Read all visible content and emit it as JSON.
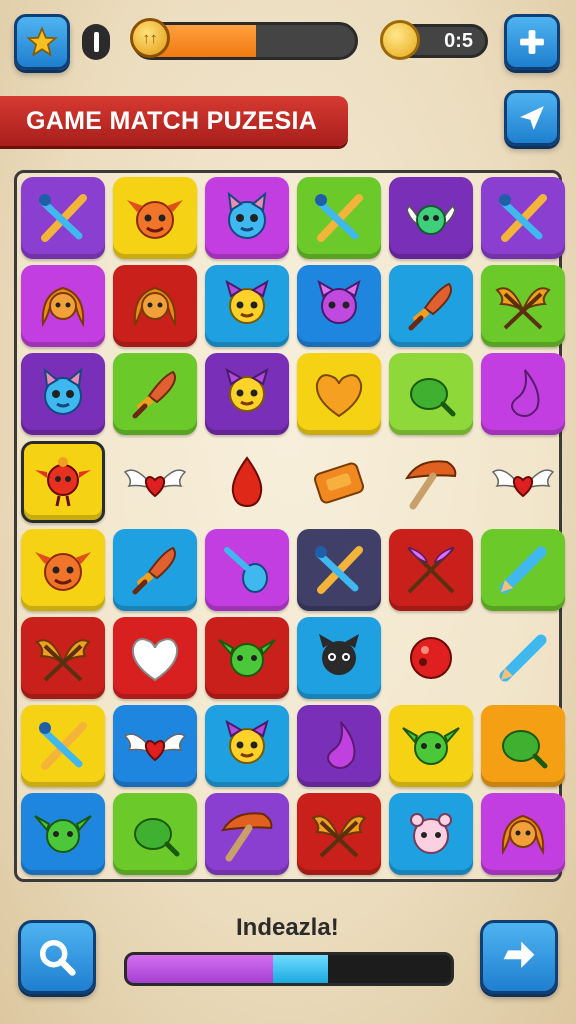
{
  "header": {
    "star_icon": "star-icon",
    "pause_icon": "pause-icon",
    "level_progress": 0.55,
    "coin_symbol": "↑↑",
    "timer": "0:5",
    "plus_icon": "plus-icon",
    "send_icon": "send-icon"
  },
  "title": "GAME MATCH PUZESIA",
  "board": {
    "rows": [
      [
        {
          "color": "#8b3fd0",
          "icon": "sword"
        },
        {
          "color": "#f5d214",
          "icon": "orange-monster"
        },
        {
          "color": "#c23ee0",
          "icon": "blue-cat"
        },
        {
          "color": "#6cc92a",
          "icon": "sword"
        },
        {
          "color": "#7a2fb8",
          "icon": "winged-creature"
        },
        {
          "color": "#8b3fd0",
          "icon": "sword"
        }
      ],
      [
        {
          "color": "#c23ee0",
          "icon": "orange-girl"
        },
        {
          "color": "#c9201c",
          "icon": "orange-girl"
        },
        {
          "color": "#1fa0e0",
          "icon": "yellow-cat"
        },
        {
          "color": "#1f86e0",
          "icon": "purple-cat"
        },
        {
          "color": "#1fa0e0",
          "icon": "feather-dagger"
        },
        {
          "color": "#6cc92a",
          "icon": "golden-wings"
        }
      ],
      [
        {
          "color": "#7a2fb8",
          "icon": "blue-cat"
        },
        {
          "color": "#6cc92a",
          "icon": "feather-dagger"
        },
        {
          "color": "#7a2fb8",
          "icon": "yellow-cat"
        },
        {
          "color": "#f5d214",
          "icon": "heart"
        },
        {
          "color": "#8ed83a",
          "icon": "green-gourd"
        },
        {
          "color": "#c23ee0",
          "icon": "drop"
        }
      ],
      [
        {
          "color": "#f5d214",
          "icon": "red-bird",
          "selected": true
        },
        {
          "color": "",
          "icon": "winged-heart"
        },
        {
          "color": "",
          "icon": "red-drop"
        },
        {
          "color": "",
          "icon": "orange-block"
        },
        {
          "color": "",
          "icon": "mushroom"
        },
        {
          "color": "",
          "icon": "winged-heart"
        }
      ],
      [
        {
          "color": "#f5d214",
          "icon": "orange-monster"
        },
        {
          "color": "#1fa0e0",
          "icon": "feather-dagger"
        },
        {
          "color": "#c23ee0",
          "icon": "blue-spoon"
        },
        {
          "color": "#3f3f68",
          "icon": "sword"
        },
        {
          "color": "#c9201c",
          "icon": "crossed-arrows"
        },
        {
          "color": "#6cc92a",
          "icon": "pencil"
        }
      ],
      [
        {
          "color": "#c9201c",
          "icon": "golden-wings"
        },
        {
          "color": "#d82020",
          "icon": "white-heart"
        },
        {
          "color": "#c9201c",
          "icon": "green-goblin"
        },
        {
          "color": "#1fa0e0",
          "icon": "black-cat"
        },
        {
          "color": "",
          "icon": "red-ball"
        },
        {
          "color": "",
          "icon": "pencil"
        }
      ],
      [
        {
          "color": "#f5d214",
          "icon": "sword"
        },
        {
          "color": "#1f86e0",
          "icon": "winged-heart"
        },
        {
          "color": "#1fa0e0",
          "icon": "yellow-cat"
        },
        {
          "color": "#7a2fb8",
          "icon": "drop"
        },
        {
          "color": "#f5d214",
          "icon": "green-goblin"
        },
        {
          "color": "#f5a014",
          "icon": "green-gourd"
        }
      ],
      [
        {
          "color": "#1f86e0",
          "icon": "green-goblin"
        },
        {
          "color": "#6cc92a",
          "icon": "green-gourd"
        },
        {
          "color": "#8b3fd0",
          "icon": "mushroom"
        },
        {
          "color": "#c9201c",
          "icon": "golden-wings"
        },
        {
          "color": "#1fa0e0",
          "icon": "pink-bear"
        },
        {
          "color": "#c23ee0",
          "icon": "orange-girl"
        }
      ]
    ]
  },
  "footer": {
    "search_icon": "search-icon",
    "hint_label": "Indeazla!",
    "purple_progress": 0.45,
    "blue_progress": 0.17,
    "next_icon": "arrow-right-icon"
  }
}
